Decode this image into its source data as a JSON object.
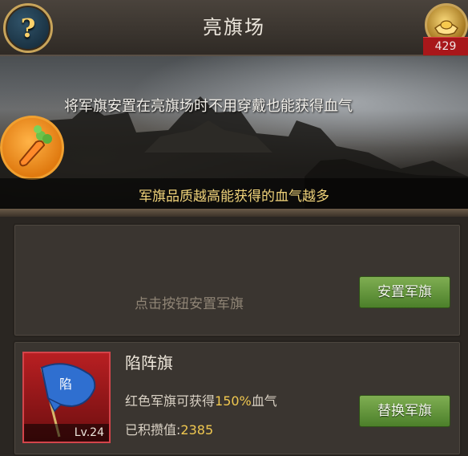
{
  "header": {
    "title": "亮旗场",
    "help_icon": "question-icon",
    "help_symbol": "?",
    "gold_icon": "gold-ingot-icon",
    "gold_count": "429"
  },
  "banner": {
    "icon": "carrot-icon",
    "line1": "将军旗安置在亮旗场时不用穿戴也能获得血气",
    "line2": "军旗品质越高能获得的血气越多"
  },
  "empty_slot": {
    "hint": "点击按钮安置军旗",
    "button_label": "安置军旗"
  },
  "flag_slot": {
    "flag_icon": "blue-banner-icon",
    "flag_char": "陷",
    "level": "Lv.24",
    "name": "陷阵旗",
    "desc_prefix": "红色军旗可获得",
    "desc_value": "150%",
    "desc_suffix": "血气",
    "score_label": "已积攒值:",
    "score_value": "2385",
    "button_label": "替换军旗"
  },
  "colors": {
    "button_green": "#5f9438",
    "highlight": "#f0c850",
    "red_card": "#b81f22",
    "gold_badge": "#a8171a"
  }
}
